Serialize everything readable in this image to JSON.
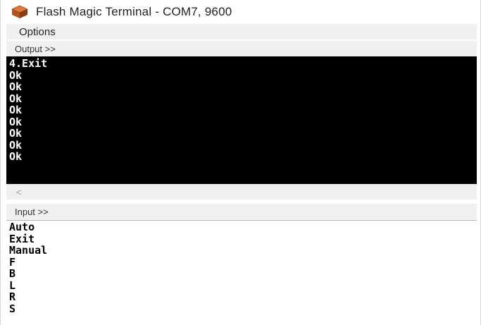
{
  "window": {
    "title": "Flash Magic Terminal - COM7, 9600",
    "icon": "flash-magic-app-icon"
  },
  "menu": {
    "items": [
      {
        "label": "Options"
      }
    ]
  },
  "output": {
    "label": "Output >>",
    "lines": [
      "4.Exit",
      "Ok",
      "Ok",
      "Ok",
      "Ok",
      "Ok",
      "Ok",
      "Ok",
      "Ok"
    ],
    "background": "#000000",
    "text_color": "#ffffff"
  },
  "scrollbar": {
    "left_arrow": "<"
  },
  "input": {
    "label": "Input >>",
    "lines": [
      "Auto",
      "Exit",
      "Manual",
      "F",
      "B",
      "L",
      "R",
      "S"
    ]
  }
}
